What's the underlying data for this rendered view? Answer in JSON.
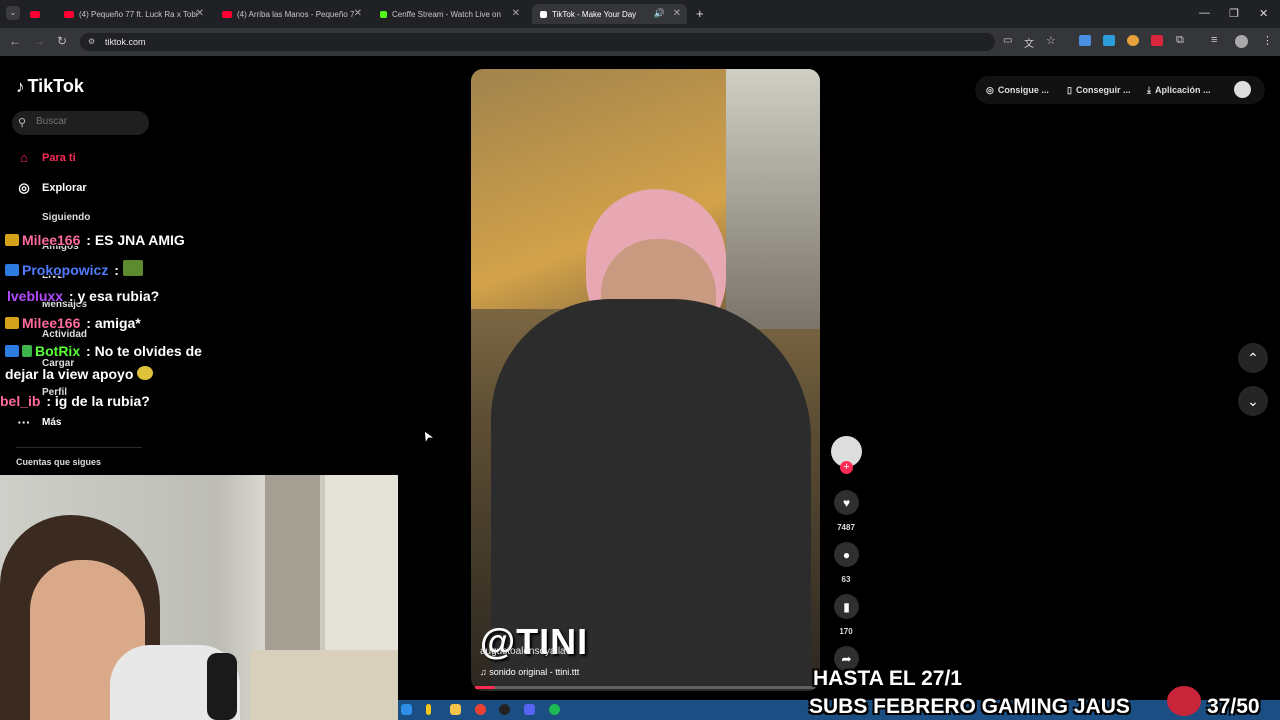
{
  "browser": {
    "tabs": [
      {
        "label": "(4) Pequeño 77 ft. Luck Ra x Tobi",
        "color": "#ff0033"
      },
      {
        "label": "(4) Arriba las Manos - Pequeño 7",
        "color": "#ff0033"
      },
      {
        "label": "Cenffe Stream - Watch Live on",
        "color": "#53fc18"
      },
      {
        "label": "TikTok - Make Your Day",
        "color": "#ffffff"
      }
    ],
    "new_tab": "+",
    "url": "tiktok.com"
  },
  "tiktok": {
    "logo": "TikTok",
    "search_placeholder": "Buscar",
    "nav": {
      "for_you": "Para ti",
      "explore": "Explorar",
      "following": "Siguiendo",
      "friends": "Amigos",
      "live": "LIVE",
      "messages": "Mensajes",
      "activity": "Actividad",
      "upload": "Cargar",
      "profile": "Perfil",
      "more": "Más"
    },
    "following_accounts_title": "Cuentas que sigues",
    "top_buttons": {
      "coins": "Consigue ...",
      "get_app": "Conseguir ...",
      "desktop_app": "Aplicación ..."
    },
    "video": {
      "overlay_handle": "@TINI",
      "username": "augustoalonsoyalla",
      "sound": "sonido original - ttini.ttt",
      "progress": 0.06
    },
    "actions": {
      "likes": "7487",
      "comments": "63",
      "saves": "170"
    }
  },
  "chat": [
    {
      "user": "Milee166",
      "sep": ":",
      "text": "ES JNA AMIG",
      "color": "#ff6b9a"
    },
    {
      "user": "Prokopowicz",
      "sep": ":",
      "text": "",
      "color": "#4f7cff"
    },
    {
      "user": "lvebluxx",
      "sep": ":",
      "text": "y esa rubia?",
      "color": "#b44bff"
    },
    {
      "user": "Milee166",
      "sep": ":",
      "text": "amiga*",
      "color": "#ff6b9a"
    },
    {
      "user": "BotRix",
      "sep": ":",
      "text": "No te olvides de",
      "color": "#5bff3b"
    },
    {
      "user": "",
      "sep": "",
      "text": "dejar la view apoyo",
      "color": "#ffffff"
    },
    {
      "user": "bel_ib",
      "sep": ":",
      "text": "ig de la rubia?",
      "color": "#ff6b9a"
    }
  ],
  "stream_overlay": {
    "line1": "HASTA EL 27/1",
    "line2": "SUBS FEBRERO GAMING JAUS",
    "counter": "37/50"
  }
}
